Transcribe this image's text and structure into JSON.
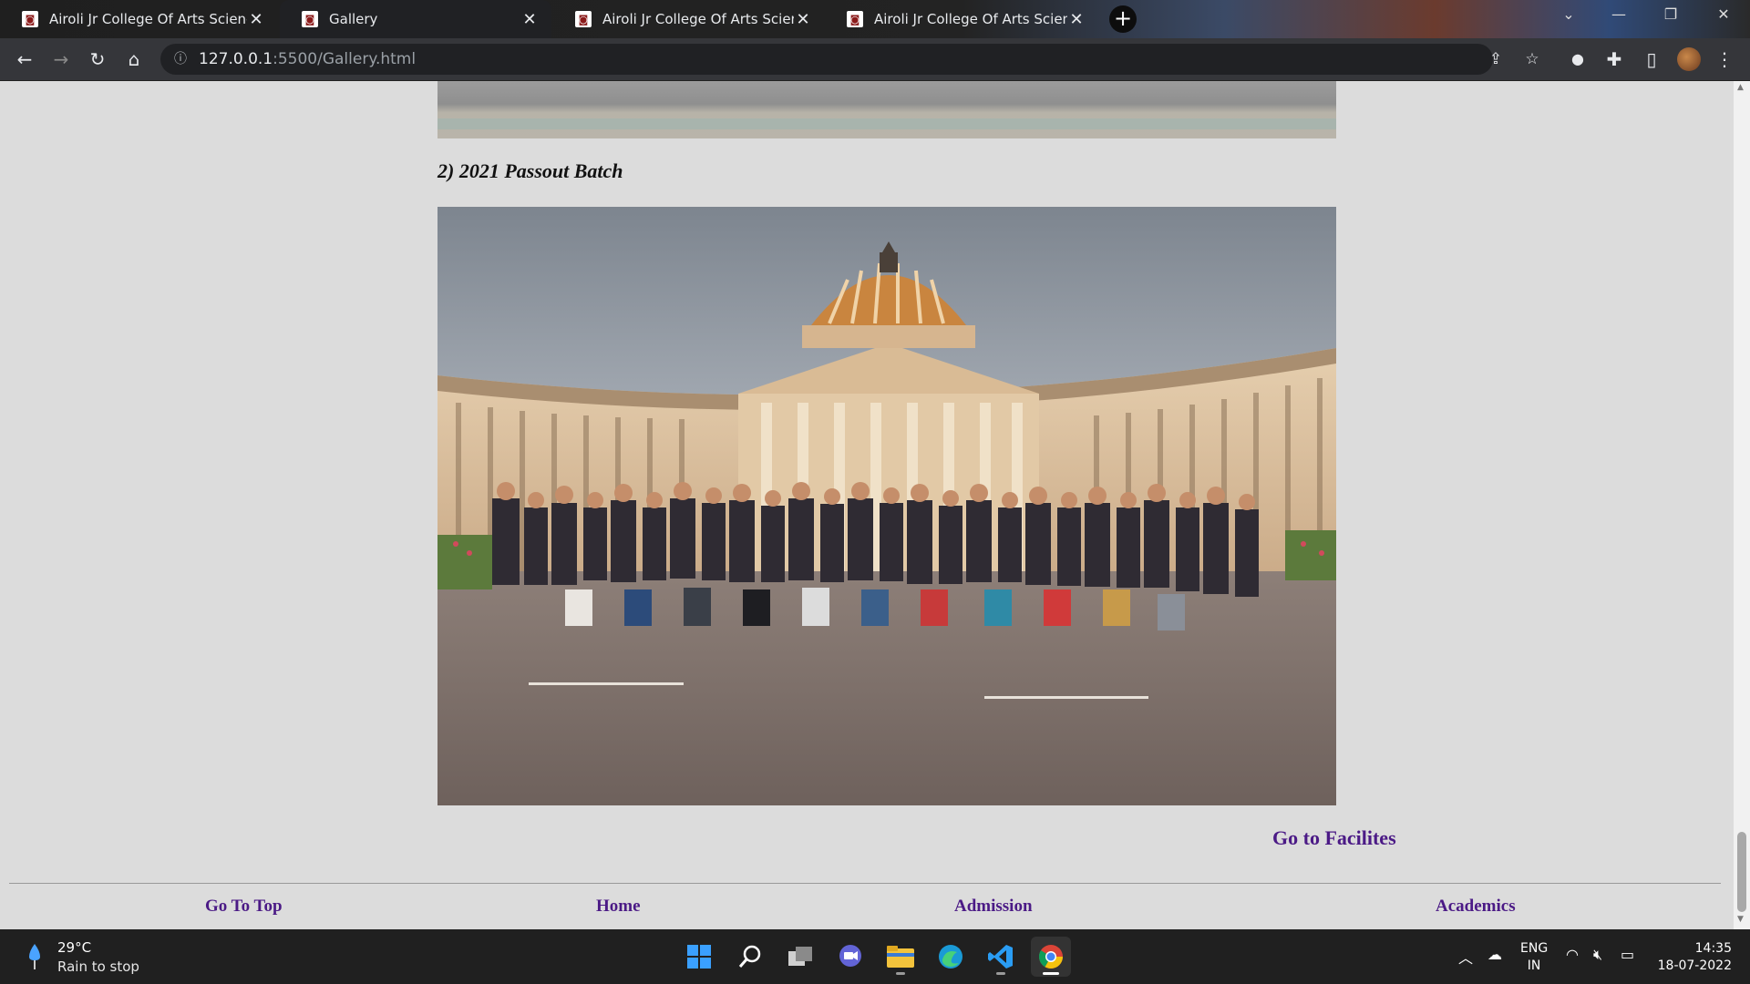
{
  "browser": {
    "tabs": [
      {
        "title": "Airoli Jr College Of Arts Science /",
        "active": false
      },
      {
        "title": "Gallery",
        "active": true
      },
      {
        "title": "Airoli Jr College Of Arts Science /",
        "active": false
      },
      {
        "title": "Airoli Jr College Of Arts Science /",
        "active": false
      }
    ],
    "url_host": "127.0.0.1",
    "url_path": ":5500/Gallery.html",
    "icons": [
      "back-icon",
      "forward-icon",
      "reload-icon",
      "home-icon",
      "info-icon",
      "share-icon",
      "star-icon",
      "extension-icon",
      "puzzle-icon",
      "sidebar-icon",
      "menu-icon"
    ]
  },
  "page": {
    "section_heading": "2) 2021 Passout Batch",
    "go_to_facilities": "Go to Facilites",
    "footer_links": {
      "go_to_top": "Go To Top",
      "home": "Home",
      "admission": "Admission",
      "academics": "Academics"
    }
  },
  "taskbar": {
    "weather_temp": "29°C",
    "weather_desc": "Rain to stop",
    "lang_line1": "ENG",
    "lang_line2": "IN",
    "time": "14:35",
    "date": "18-07-2022",
    "apps": [
      "start",
      "search",
      "task-view",
      "teams",
      "file-explorer",
      "edge",
      "vscode",
      "chrome"
    ]
  },
  "colors": {
    "link": "#4b1a86",
    "page_bg": "#dcdcdc",
    "taskbar_bg": "#202020"
  }
}
